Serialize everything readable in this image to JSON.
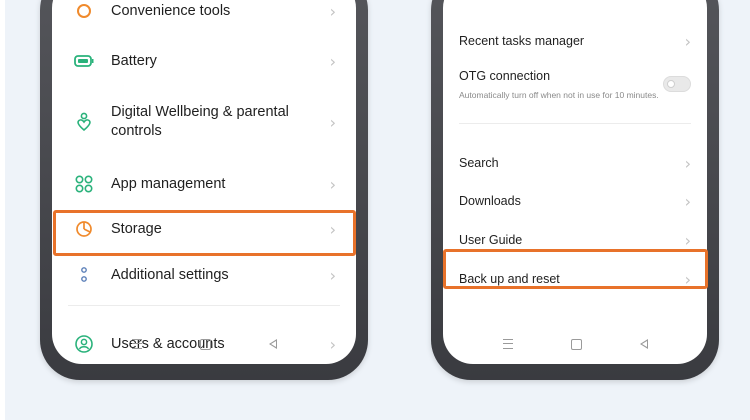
{
  "left_phone": {
    "partial_top_label": "Convenience tools",
    "items": [
      {
        "label": "Battery",
        "icon": "battery-icon"
      },
      {
        "label": "Digital Wellbeing & parental controls",
        "icon": "wellbeing-icon"
      },
      {
        "label": "App management",
        "icon": "app-grid-icon"
      },
      {
        "label": "Storage",
        "icon": "storage-pie-icon"
      },
      {
        "label": "Additional settings",
        "icon": "more-dots-icon",
        "highlighted": true
      },
      {
        "label": "Users & accounts",
        "icon": "user-icon"
      }
    ]
  },
  "right_phone": {
    "items": [
      {
        "label": "Recent tasks manager"
      },
      {
        "label": "OTG connection",
        "sublabel": "Automatically turn off when not in use for 10 minutes.",
        "toggle": "off"
      },
      {
        "label": "Search"
      },
      {
        "label": "Downloads"
      },
      {
        "label": "User Guide"
      },
      {
        "label": "Back up and reset",
        "highlighted": true
      }
    ]
  },
  "colors": {
    "highlight": "#e8722a",
    "icon_green": "#2ab27b",
    "icon_orange": "#f08a2c",
    "icon_blue": "#5b7fb8",
    "background": "#eef3f9"
  },
  "navbar_icons": [
    "menu-icon",
    "home-icon",
    "back-icon"
  ]
}
